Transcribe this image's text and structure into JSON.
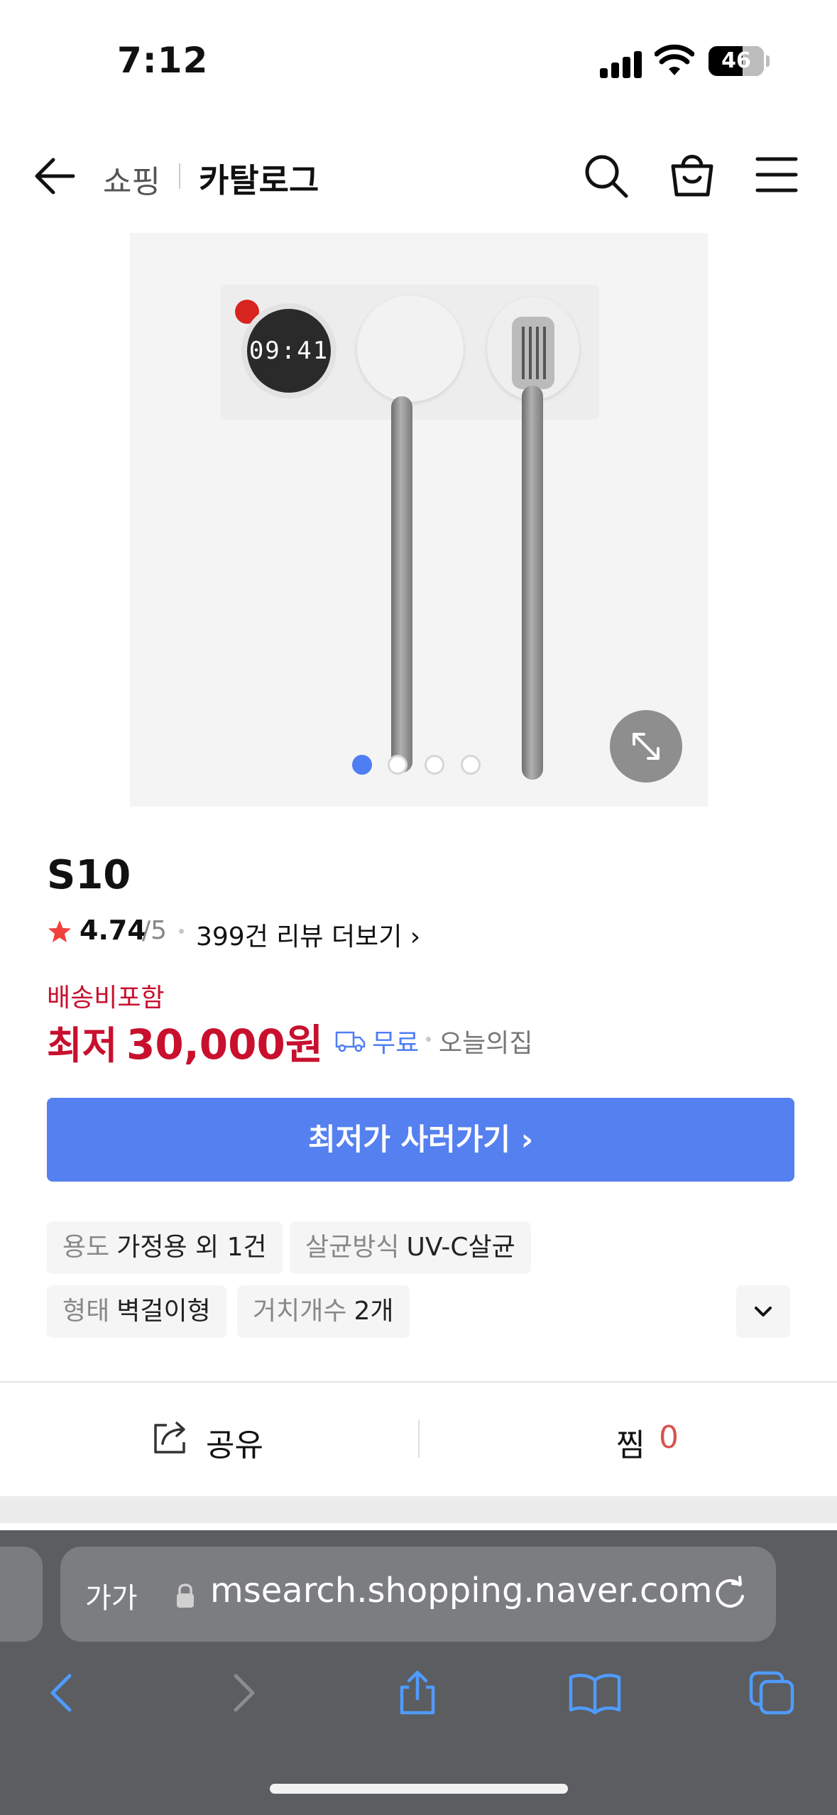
{
  "status_bar": {
    "time": "7:12",
    "battery_level": "46"
  },
  "header": {
    "breadcrumb_shopping": "쇼핑",
    "breadcrumb_catalog": "카탈로그"
  },
  "product_image": {
    "clock_display": "09:41",
    "slide_count": 4,
    "active_slide": 1
  },
  "product": {
    "name": "S10",
    "rating": "4.74",
    "rating_max": "/5",
    "review_link": "399건 리뷰 더보기 ›",
    "shipping_note": "배송비포함",
    "price_prefix": "최저",
    "price": "30,000원",
    "delivery": "무료",
    "delivery_seller": "오늘의집"
  },
  "buy_button": {
    "label": "최저가 사러가기 ›"
  },
  "specs": [
    {
      "key": "용도",
      "value": "가정용 외 1건"
    },
    {
      "key": "살균방식",
      "value": "UV-C살균"
    },
    {
      "key": "형태",
      "value": "벽걸이형"
    },
    {
      "key": "거치개수",
      "value": "2개"
    }
  ],
  "actions": {
    "share_label": "공유",
    "wish_label": "찜",
    "wish_count": "0"
  },
  "browser": {
    "aa_label": "가가",
    "url": "msearch.shopping.naver.com"
  },
  "colors": {
    "accent_blue": "#5580f0",
    "price_red": "#c8102e",
    "star_red": "#f0413c",
    "browser_chrome": "#5b5d60"
  }
}
